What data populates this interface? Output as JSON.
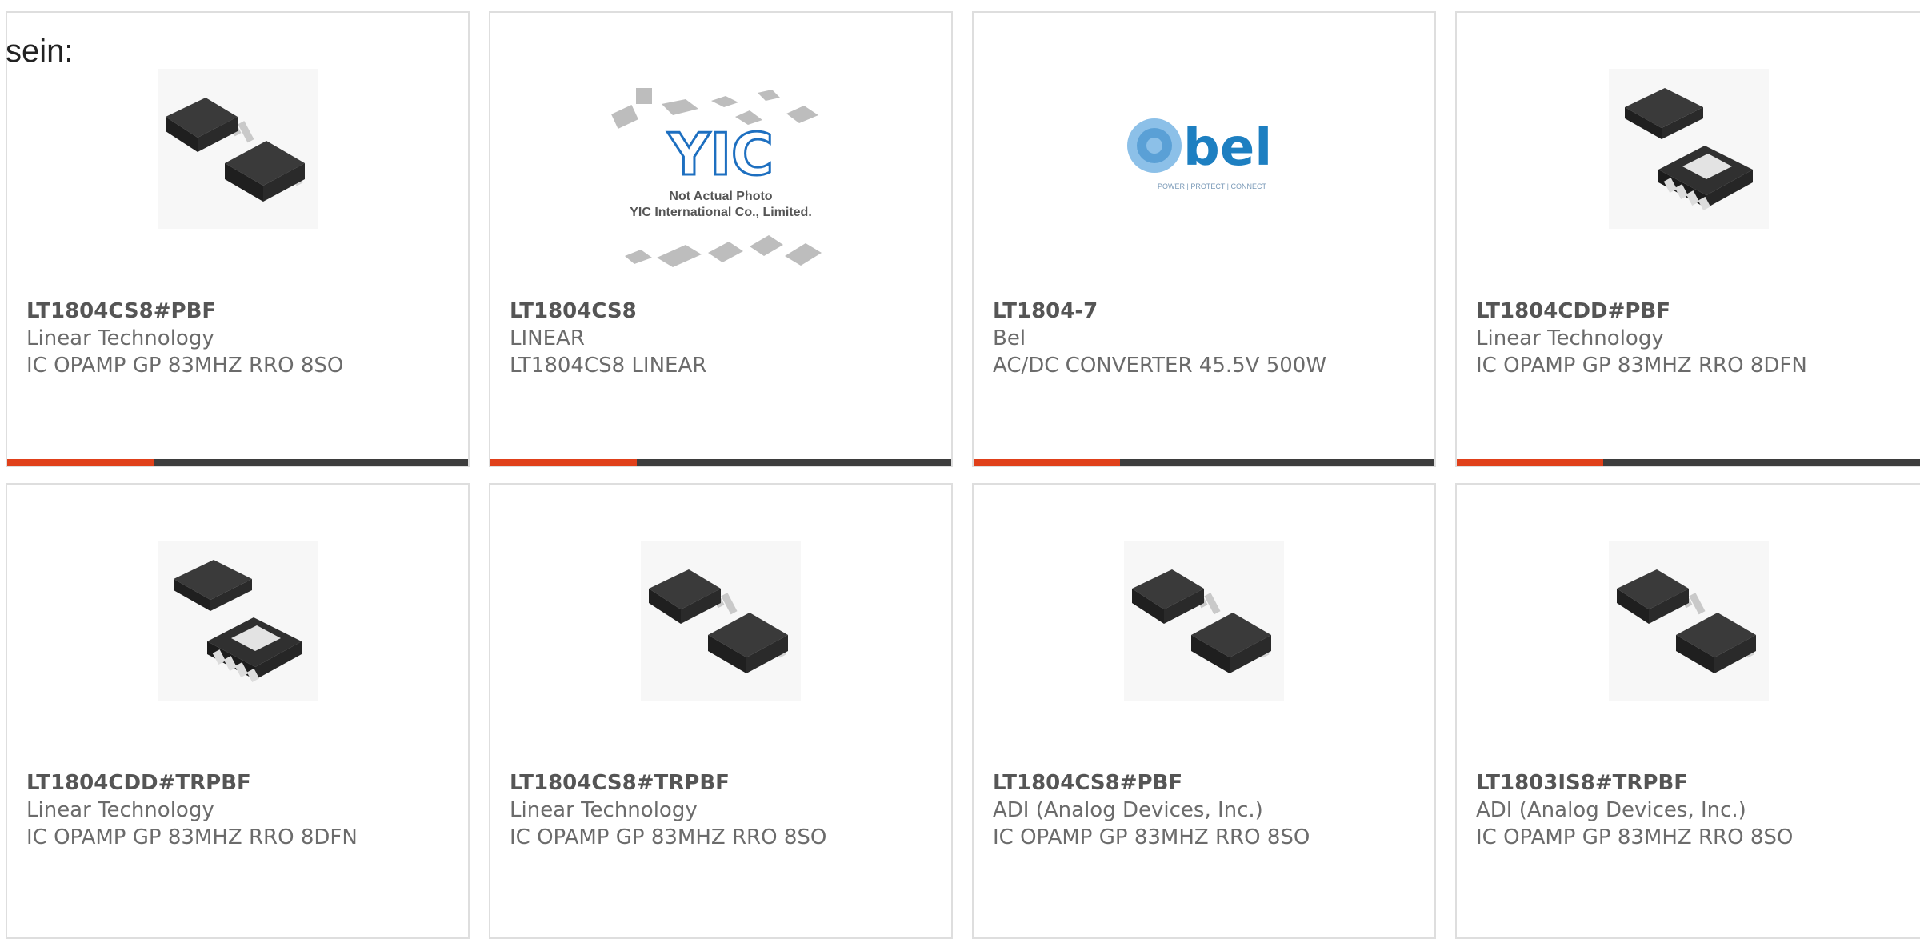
{
  "page": {
    "lead_text": "sein:"
  },
  "colors": {
    "accent": "#e0401a",
    "bar_dark": "#3d3d3d",
    "card_border": "#dedede",
    "text": "#6b6b6b",
    "bel_blue": "#1d7fc1"
  },
  "products": [
    {
      "part": "LT1804CS8#PBF",
      "manufacturer": "Linear Technology",
      "description": "IC OPAMP GP 83MHZ RRO 8SO",
      "image": "soic8-chip-icon"
    },
    {
      "part": "LT1804CS8",
      "manufacturer": "LINEAR",
      "description": "LT1804CS8 LINEAR",
      "image": "yic-placeholder-icon",
      "placeholder": {
        "brand": "YIC",
        "line1": "Not Actual Photo",
        "line2": "YIC International Co., Limited."
      }
    },
    {
      "part": "LT1804-7",
      "manufacturer": "Bel",
      "description": "AC/DC CONVERTER 45.5V 500W",
      "image": "bel-logo-icon",
      "logo": {
        "name": "bel",
        "tagline": "POWER | PROTECT | CONNECT"
      }
    },
    {
      "part": "LT1804CDD#PBF",
      "manufacturer": "Linear Technology",
      "description": "IC OPAMP GP 83MHZ RRO 8DFN",
      "image": "dfn8-chip-icon"
    },
    {
      "part": "LT1804CDD#TRPBF",
      "manufacturer": "Linear Technology",
      "description": "IC OPAMP GP 83MHZ RRO 8DFN",
      "image": "dfn8-chip-icon"
    },
    {
      "part": "LT1804CS8#TRPBF",
      "manufacturer": "Linear Technology",
      "description": "IC OPAMP GP 83MHZ RRO 8SO",
      "image": "soic8-chip-icon"
    },
    {
      "part": "LT1804CS8#PBF",
      "manufacturer": "ADI (Analog Devices, Inc.)",
      "description": "IC OPAMP GP 83MHZ RRO 8SO",
      "image": "soic8-chip-icon"
    },
    {
      "part": "LT1803IS8#TRPBF",
      "manufacturer": "ADI (Analog Devices, Inc.)",
      "description": "IC OPAMP GP 83MHZ RRO 8SO",
      "image": "soic8-chip-icon"
    }
  ]
}
